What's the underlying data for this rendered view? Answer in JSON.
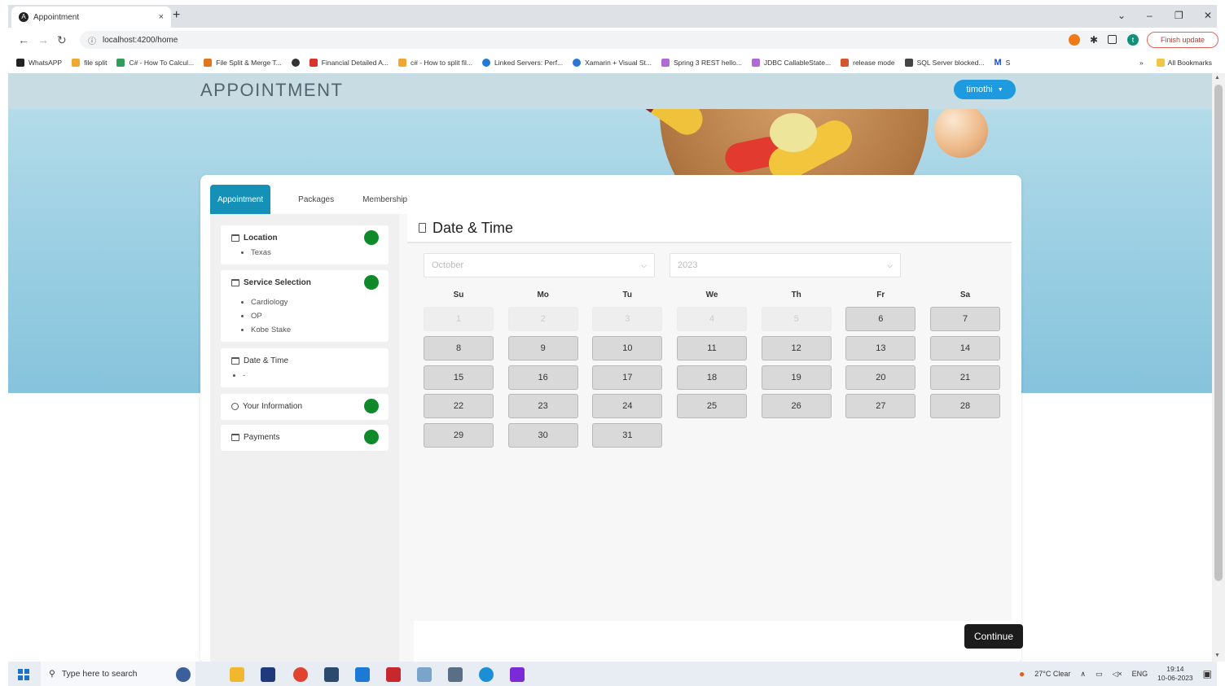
{
  "browser": {
    "tab_title": "Appointment",
    "tab_close": "×",
    "new_tab": "+",
    "url": "localhost:4200/home",
    "finish_update": "Finish update",
    "window": {
      "chevron": "⌄",
      "minimize": "–",
      "restore": "❐",
      "close": "✕"
    },
    "bookmarks": [
      {
        "label": "WhatsAPP",
        "color": "#222222"
      },
      {
        "label": "file split",
        "color": "#f0a830"
      },
      {
        "label": "C# - How To Calcul...",
        "color": "#2f9e5a"
      },
      {
        "label": "File Split & Merge T...",
        "color": "#e0761e"
      },
      {
        "label": "",
        "color": "#333333"
      },
      {
        "label": "Financial Detailed A...",
        "color": "#d9342b"
      },
      {
        "label": "c# - How to split fil...",
        "color": "#f0a830"
      },
      {
        "label": "Linked Servers: Perf...",
        "color": "#1f7bd6"
      },
      {
        "label": "Xamarin + Visual St...",
        "color": "#2a76d2"
      },
      {
        "label": "Spring 3 REST hello...",
        "color": "#b06ad8"
      },
      {
        "label": "JDBC CallableState...",
        "color": "#b06ad8"
      },
      {
        "label": "release mode",
        "color": "#d6542e"
      },
      {
        "label": "SQL Server blocked...",
        "color": "#444444"
      },
      {
        "label": "S",
        "color": "#1a4fd0"
      }
    ],
    "bookmarks_more": "»",
    "all_bookmarks": "All Bookmarks"
  },
  "app": {
    "brand": "APPOINTMENT",
    "user_name": "timothi",
    "tabs": [
      {
        "label": "Appointment",
        "active": true
      },
      {
        "label": "Packages",
        "active": false
      },
      {
        "label": "Membership",
        "active": false
      }
    ],
    "steps": {
      "location": {
        "label": "Location",
        "items": [
          "Texas"
        ]
      },
      "service": {
        "label": "Service Selection",
        "items": [
          "Cardiology",
          "OP",
          "Kobe Stake"
        ]
      },
      "datetime": {
        "label": "Date & Time",
        "items": [
          "-"
        ]
      },
      "info": {
        "label": "Your Information"
      },
      "payments": {
        "label": "Payments"
      }
    },
    "section_title": "Date & Time",
    "month_select": {
      "value": "October"
    },
    "year_select": {
      "value": "2023"
    },
    "weekdays": [
      "Su",
      "Mo",
      "Tu",
      "We",
      "Th",
      "Fr",
      "Sa"
    ],
    "continue_label": "Continue"
  },
  "calendar": {
    "weeks": [
      [
        {
          "d": "1",
          "on": false
        },
        {
          "d": "2",
          "on": false
        },
        {
          "d": "3",
          "on": false
        },
        {
          "d": "4",
          "on": false
        },
        {
          "d": "5",
          "on": false
        },
        {
          "d": "6",
          "on": true
        },
        {
          "d": "7",
          "on": true
        }
      ],
      [
        {
          "d": "8",
          "on": true
        },
        {
          "d": "9",
          "on": true
        },
        {
          "d": "10",
          "on": true
        },
        {
          "d": "11",
          "on": true
        },
        {
          "d": "12",
          "on": true
        },
        {
          "d": "13",
          "on": true
        },
        {
          "d": "14",
          "on": true
        }
      ],
      [
        {
          "d": "15",
          "on": true
        },
        {
          "d": "16",
          "on": true
        },
        {
          "d": "17",
          "on": true
        },
        {
          "d": "18",
          "on": true
        },
        {
          "d": "19",
          "on": true
        },
        {
          "d": "20",
          "on": true
        },
        {
          "d": "21",
          "on": true
        }
      ],
      [
        {
          "d": "22",
          "on": true
        },
        {
          "d": "23",
          "on": true
        },
        {
          "d": "24",
          "on": true
        },
        {
          "d": "25",
          "on": true
        },
        {
          "d": "26",
          "on": true
        },
        {
          "d": "27",
          "on": true
        },
        {
          "d": "28",
          "on": true
        }
      ],
      [
        {
          "d": "29",
          "on": true
        },
        {
          "d": "30",
          "on": true
        },
        {
          "d": "31",
          "on": true
        }
      ]
    ]
  },
  "taskbar": {
    "search_placeholder": "Type here to search",
    "weather": "27°C  Clear",
    "language": "ENG",
    "time": "19:14",
    "date": "10-06-2023"
  },
  "colors": {
    "accent_tab": "#1591b8",
    "user_button": "#1e9be0",
    "status_done": "#0e8a2a",
    "continue_button": "#1c1c1c"
  }
}
